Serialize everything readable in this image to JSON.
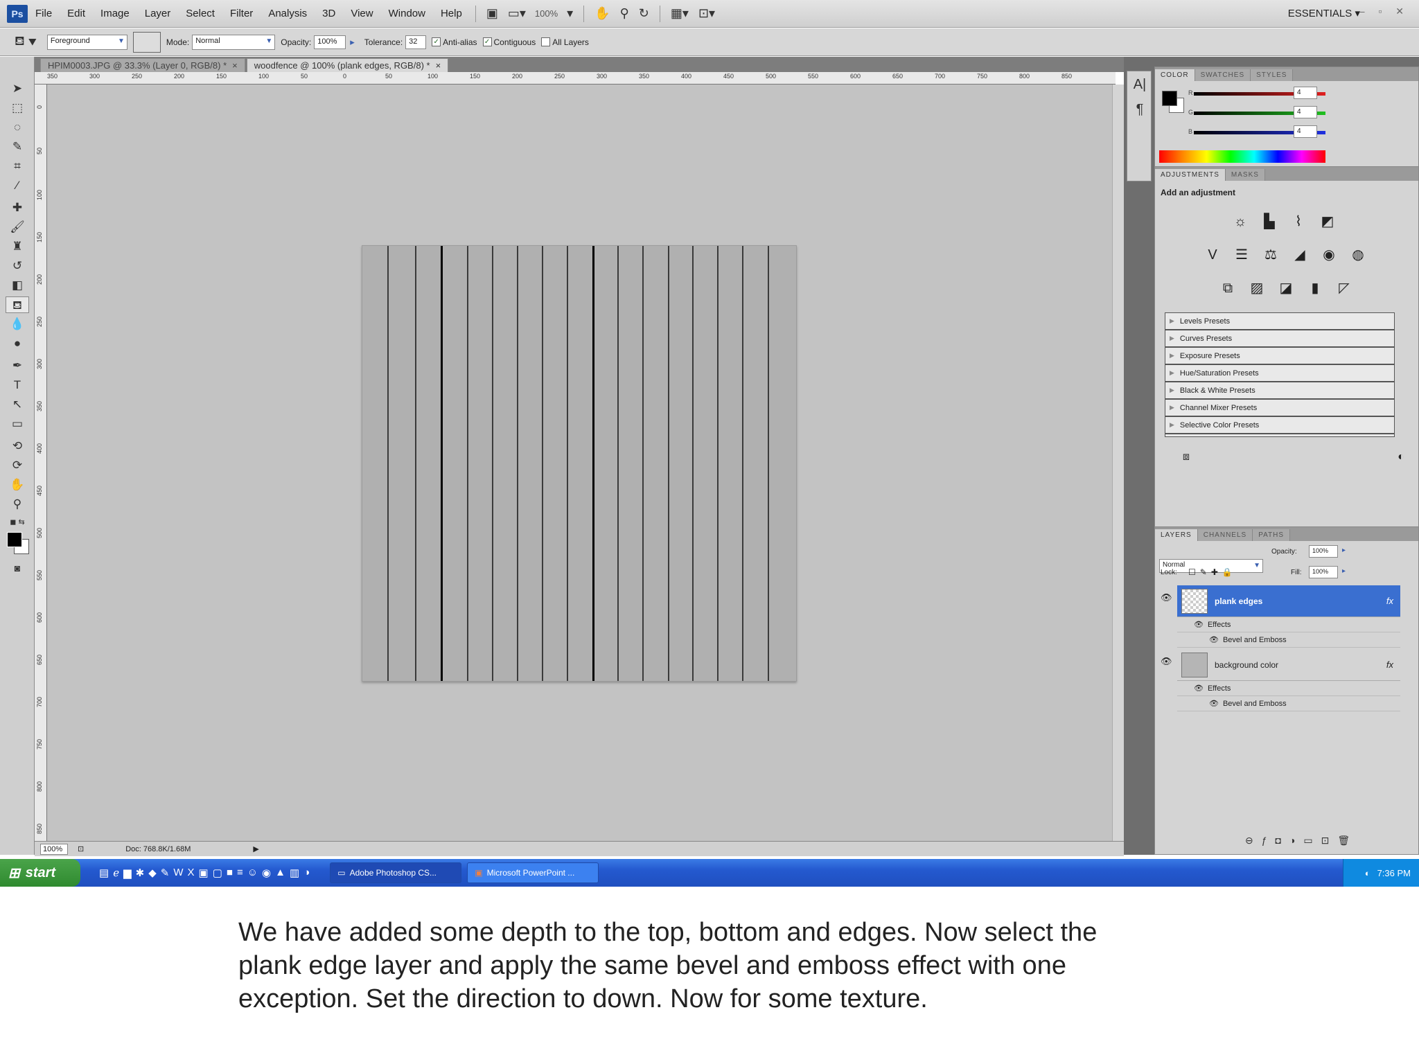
{
  "app": {
    "logo": "Ps",
    "menu": [
      "File",
      "Edit",
      "Image",
      "Layer",
      "Select",
      "Filter",
      "Analysis",
      "3D",
      "View",
      "Window",
      "Help"
    ],
    "zoom_display": "100%",
    "workspace": "ESSENTIALS",
    "window_controls": "–  ▫  ✕"
  },
  "options": {
    "fill_source": "Foreground",
    "mode_label": "Mode:",
    "mode_value": "Normal",
    "opacity_label": "Opacity:",
    "opacity_value": "100%",
    "tolerance_label": "Tolerance:",
    "tolerance_value": "32",
    "antialias_label": "Anti-alias",
    "antialias_checked": true,
    "contiguous_label": "Contiguous",
    "contiguous_checked": true,
    "all_layers_label": "All Layers",
    "all_layers_checked": false
  },
  "documents": {
    "tabs": [
      {
        "title": "HPIM0003.JPG @ 33.3% (Layer 0, RGB/8) *",
        "close": "×"
      },
      {
        "title": "woodfence @ 100% (plank edges, RGB/8) *",
        "close": "×"
      }
    ],
    "active_index": 1
  },
  "ruler": {
    "h_labels": [
      "350",
      "300",
      "250",
      "200",
      "150",
      "100",
      "50",
      "0",
      "50",
      "100",
      "150",
      "200",
      "250",
      "300",
      "350",
      "400",
      "450",
      "500",
      "550",
      "600",
      "650",
      "700",
      "750",
      "800",
      "850"
    ],
    "v_labels": [
      "0",
      "50",
      "100",
      "150",
      "200",
      "250",
      "300",
      "350",
      "400",
      "450",
      "500",
      "550",
      "600",
      "650",
      "700",
      "750",
      "800",
      "850"
    ]
  },
  "status": {
    "zoom": "100%",
    "doc": "Doc: 768.8K/1.68M"
  },
  "canvas": {
    "fence_bg": "#b0b0b0",
    "plank_boundaries": [
      0.058,
      0.122,
      0.181,
      0.241,
      0.298,
      0.356,
      0.414,
      0.472,
      0.53,
      0.588,
      0.646,
      0.704,
      0.76,
      0.818,
      0.876,
      0.934
    ],
    "dark_boundaries": [
      0.181,
      0.53
    ]
  },
  "color_panel": {
    "tabs": [
      "COLOR",
      "SWATCHES",
      "STYLES"
    ],
    "rows": [
      {
        "label": "R",
        "value": "4",
        "color": "#e02020"
      },
      {
        "label": "G",
        "value": "4",
        "color": "#20c020"
      },
      {
        "label": "B",
        "value": "4",
        "color": "#2030e0"
      }
    ]
  },
  "adjustments_panel": {
    "tabs": [
      "ADJUSTMENTS",
      "MASKS"
    ],
    "title": "Add an adjustment",
    "presets": [
      "Levels Presets",
      "Curves Presets",
      "Exposure Presets",
      "Hue/Saturation Presets",
      "Black & White Presets",
      "Channel Mixer Presets",
      "Selective Color Presets"
    ]
  },
  "layers_panel": {
    "tabs": [
      "LAYERS",
      "CHANNELS",
      "PATHS"
    ],
    "blend_mode": "Normal",
    "opacity_label": "Opacity:",
    "opacity_value": "100%",
    "lock_label": "Lock:",
    "fill_label": "Fill:",
    "fill_value": "100%",
    "layers": [
      {
        "name": "plank edges",
        "effects_label": "Effects",
        "effect": "Bevel and Emboss",
        "fx": "fx",
        "selected": true
      },
      {
        "name": "background color",
        "effects_label": "Effects",
        "effect": "Bevel and Emboss",
        "fx": "fx",
        "selected": false
      }
    ]
  },
  "taskbar": {
    "start": "start",
    "tasks": [
      "Adobe Photoshop CS...",
      "Microsoft PowerPoint ..."
    ],
    "clock": "7:36 PM"
  },
  "caption": "We have added some depth to the top, bottom and edges.  Now select the plank edge layer and apply the same bevel and emboss effect with one exception.  Set the direction to down.  Now for some texture."
}
